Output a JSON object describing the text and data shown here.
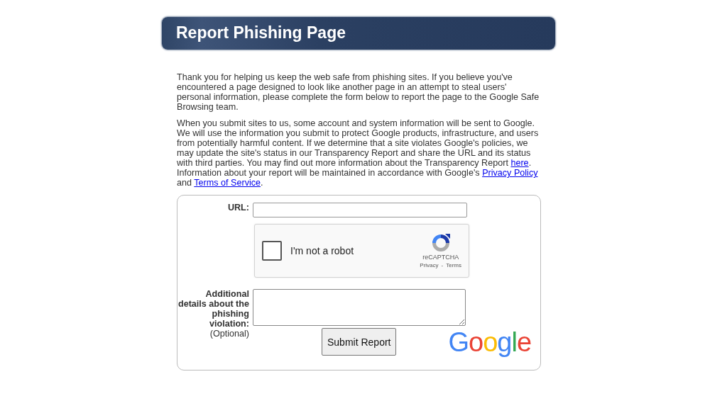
{
  "header": {
    "title": "Report Phishing Page"
  },
  "intro": [
    [
      {
        "kind": "text",
        "text": "Thank you for helping us keep the web safe from phishing sites. If you believe you've encountered a page designed to look like another page in an attempt to steal users' personal information, please complete the form below to report the page to the Google Safe Browsing team."
      }
    ],
    [
      {
        "kind": "text",
        "text": "When you submit sites to us, some account and system information will be sent to Google. We will use the information you submit to protect Google products, infrastructure, and users from potentially harmful content. If we determine that a site violates Google's policies, we may update the site's status in our Transparency Report and share the URL and its status with third parties. You may find out more information about the Transparency Report "
      },
      {
        "kind": "link",
        "text": "here"
      },
      {
        "kind": "text",
        "text": ". Information about your report will be maintained in accordance with Google's "
      },
      {
        "kind": "link",
        "text": "Privacy Policy"
      },
      {
        "kind": "text",
        "text": " and "
      },
      {
        "kind": "link",
        "text": "Terms of Service"
      },
      {
        "kind": "text",
        "text": "."
      }
    ]
  ],
  "form": {
    "url_label": "URL:",
    "captcha": {
      "label": "I'm not a robot",
      "checked": false,
      "brand": "reCAPTCHA",
      "privacy": "Privacy",
      "separator": "-",
      "terms": "Terms"
    },
    "details_label": "Additional details about the phishing violation:",
    "optional": "(Optional)",
    "submit": "Submit Report",
    "logo": "Google"
  }
}
